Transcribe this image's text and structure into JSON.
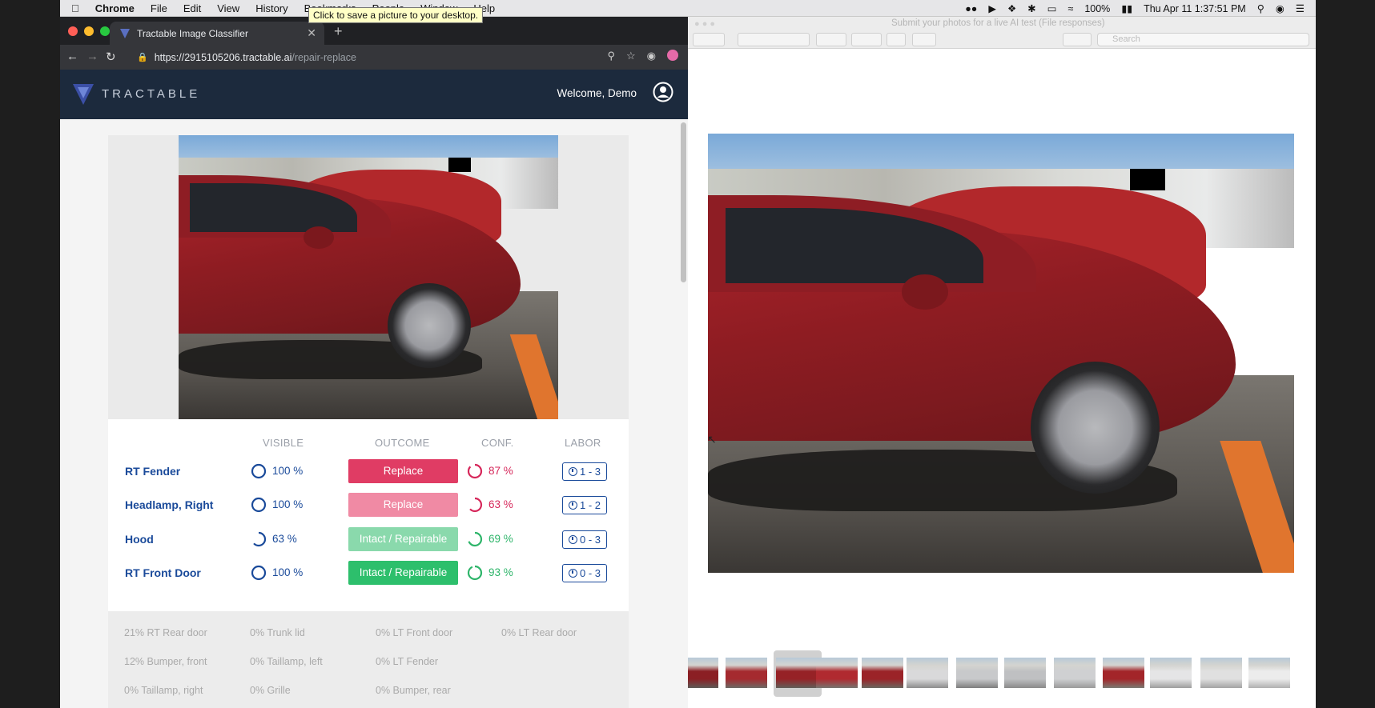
{
  "menubar": {
    "app": "Chrome",
    "items": [
      "File",
      "Edit",
      "View",
      "History",
      "Bookmarks",
      "People",
      "Window",
      "Help"
    ],
    "battery": "100%",
    "datetime": "Thu Apr 11  1:37:51 PM"
  },
  "tooltip": "Click to save a picture to your desktop.",
  "browser": {
    "tab_title": "Tractable Image Classifier",
    "url_host": "https://2915105206.tractable.ai",
    "url_path": "/repair-replace"
  },
  "app": {
    "logo_text": "TRACTABLE",
    "welcome": "Welcome, Demo"
  },
  "results": {
    "headers": {
      "visible": "VISIBLE",
      "outcome": "OUTCOME",
      "conf": "CONF.",
      "labor": "LABOR"
    },
    "rows": [
      {
        "part": "RT Fender",
        "visible": "100 %",
        "visible_value": 1.0,
        "outcome": "Replace",
        "outcome_color": "#e03c64",
        "conf": "87 %",
        "conf_value": 0.87,
        "conf_color": "#d6275a",
        "labor": "1 - 3"
      },
      {
        "part": "Headlamp, Right",
        "visible": "100 %",
        "visible_value": 1.0,
        "outcome": "Replace",
        "outcome_color": "#f08aa4",
        "conf": "63 %",
        "conf_value": 0.63,
        "conf_color": "#d6275a",
        "labor": "1 - 2"
      },
      {
        "part": "Hood",
        "visible": "63 %",
        "visible_value": 0.63,
        "outcome": "Intact / Repairable",
        "outcome_color": "#8ad9ac",
        "conf": "69 %",
        "conf_value": 0.69,
        "conf_color": "#2eb56a",
        "labor": "0 - 3"
      },
      {
        "part": "RT Front Door",
        "visible": "100 %",
        "visible_value": 1.0,
        "outcome": "Intact / Repairable",
        "outcome_color": "#2dbf6c",
        "conf": "93 %",
        "conf_value": 0.93,
        "conf_color": "#2eb56a",
        "labor": "0 - 3"
      }
    ],
    "others": [
      [
        "21% RT Rear door",
        "0% Trunk lid",
        "0% LT Front door",
        "0% LT Rear door"
      ],
      [
        "12% Bumper, front",
        "0% Taillamp, left",
        "0% LT Fender",
        ""
      ],
      [
        "0% Taillamp, right",
        "0% Grille",
        "0% Bumper, rear",
        ""
      ]
    ]
  },
  "preview": {
    "title": "Submit your photos for a live AI test (File responses)",
    "search_placeholder": "Search"
  }
}
